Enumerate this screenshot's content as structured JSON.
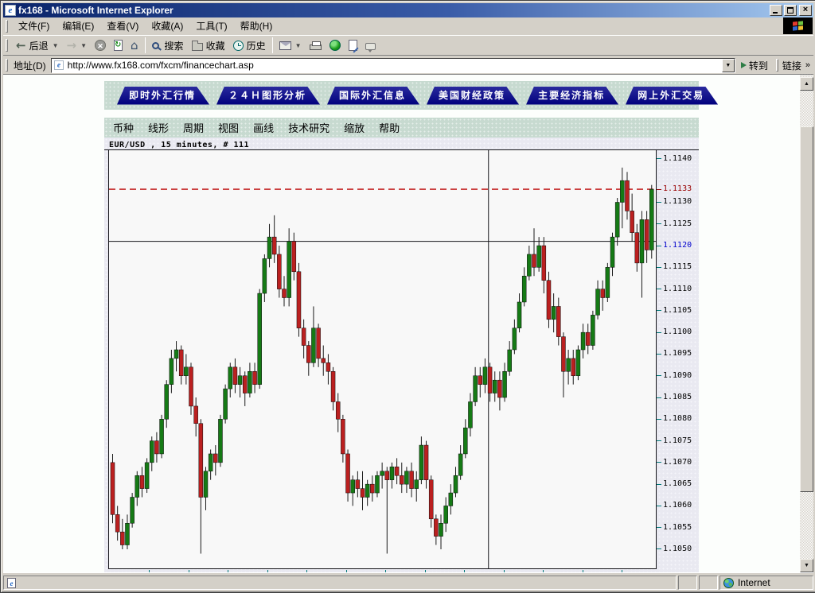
{
  "titlebar": {
    "title": "fx168 - Microsoft Internet Explorer"
  },
  "menubar": {
    "items": [
      "文件(F)",
      "编辑(E)",
      "查看(V)",
      "收藏(A)",
      "工具(T)",
      "帮助(H)"
    ]
  },
  "toolbar": {
    "back_label": "后退",
    "search_label": "搜索",
    "favorites_label": "收藏",
    "history_label": "历史"
  },
  "address": {
    "label": "地址(D)",
    "url": "http://www.fx168.com/fxcm/financechart.asp",
    "go_label": "转到",
    "links_label": "链接",
    "links_chevron": "»"
  },
  "nav_tabs": [
    "即时外汇行情",
    "２４Ｈ图形分析",
    "国际外汇信息",
    "美国财经政策",
    "主要经济指标",
    "网上外汇交易"
  ],
  "chart_menu": [
    "币种",
    "线形",
    "周期",
    "视图",
    "画线",
    "技术研究",
    "缩放",
    "帮助"
  ],
  "status": {
    "zone_label": "Internet"
  },
  "chart_data": {
    "type": "candlestick",
    "title": "EUR/USD , 15 minutes, # 111",
    "symbol": "EUR/USD",
    "interval": "15 minutes",
    "bar_count": 111,
    "ylim": [
      1.10456,
      1.1142
    ],
    "last_price": 1.1133,
    "lines": {
      "dashed_price": 1.1133,
      "dashed_color": "#bb0000",
      "solid_price": 1.1121,
      "vline_index": 76.7
    },
    "x_tick_count": 13,
    "style": {
      "up": "#157a15",
      "down": "#bb2020",
      "wick": "#1a1a1a",
      "axis_tick": "#007878",
      "bg": "#f8f8f8"
    },
    "y_ticks": [
      {
        "v": "1.1140"
      },
      {
        "v": "1.1133",
        "c": "#990000",
        "tick": "#990000"
      },
      {
        "v": "1.1130"
      },
      {
        "v": "1.1125"
      },
      {
        "v": "1.1120",
        "c": "#0000cc"
      },
      {
        "v": "1.1115"
      },
      {
        "v": "1.1110"
      },
      {
        "v": "1.1105"
      },
      {
        "v": "1.1100"
      },
      {
        "v": "1.1095"
      },
      {
        "v": "1.1090"
      },
      {
        "v": "1.1085"
      },
      {
        "v": "1.1080"
      },
      {
        "v": "1.1075"
      },
      {
        "v": "1.1070"
      },
      {
        "v": "1.1065"
      },
      {
        "v": "1.1060"
      },
      {
        "v": "1.1055"
      },
      {
        "v": "1.1050"
      }
    ],
    "candles": [
      [
        1.107,
        1.1072,
        1.1056,
        1.1058
      ],
      [
        1.1058,
        1.106,
        1.1052,
        1.1054
      ],
      [
        1.1054,
        1.1057,
        1.105,
        1.1051
      ],
      [
        1.1051,
        1.1058,
        1.105,
        1.1056
      ],
      [
        1.1056,
        1.1063,
        1.1055,
        1.1062
      ],
      [
        1.1062,
        1.1068,
        1.106,
        1.1067
      ],
      [
        1.1067,
        1.1069,
        1.1062,
        1.1064
      ],
      [
        1.1064,
        1.1071,
        1.1063,
        1.107
      ],
      [
        1.107,
        1.1076,
        1.1068,
        1.1075
      ],
      [
        1.1075,
        1.1077,
        1.107,
        1.1072
      ],
      [
        1.1072,
        1.1081,
        1.1071,
        1.108
      ],
      [
        1.108,
        1.1089,
        1.1078,
        1.1088
      ],
      [
        1.1088,
        1.1096,
        1.1086,
        1.1094
      ],
      [
        1.1094,
        1.1098,
        1.1091,
        1.1096
      ],
      [
        1.1096,
        1.1097,
        1.1088,
        1.109
      ],
      [
        1.109,
        1.1095,
        1.1088,
        1.1092
      ],
      [
        1.1092,
        1.1093,
        1.1081,
        1.1083
      ],
      [
        1.1083,
        1.1085,
        1.1076,
        1.1079
      ],
      [
        1.1079,
        1.108,
        1.1049,
        1.1062
      ],
      [
        1.1062,
        1.1069,
        1.1059,
        1.1068
      ],
      [
        1.1068,
        1.1073,
        1.1066,
        1.1072
      ],
      [
        1.1072,
        1.1074,
        1.1067,
        1.107
      ],
      [
        1.107,
        1.1081,
        1.1069,
        1.108
      ],
      [
        1.108,
        1.1088,
        1.1079,
        1.1087
      ],
      [
        1.1087,
        1.1093,
        1.1085,
        1.1092
      ],
      [
        1.1092,
        1.1094,
        1.1086,
        1.1088
      ],
      [
        1.1088,
        1.1092,
        1.1085,
        1.109
      ],
      [
        1.109,
        1.1091,
        1.1083,
        1.1086
      ],
      [
        1.1086,
        1.1093,
        1.1085,
        1.1091
      ],
      [
        1.1091,
        1.1093,
        1.1086,
        1.1088
      ],
      [
        1.1088,
        1.111,
        1.1087,
        1.1109
      ],
      [
        1.1109,
        1.1118,
        1.1107,
        1.1117
      ],
      [
        1.1117,
        1.1125,
        1.1115,
        1.1122
      ],
      [
        1.1122,
        1.1127,
        1.1116,
        1.1118
      ],
      [
        1.1118,
        1.112,
        1.1108,
        1.111
      ],
      [
        1.111,
        1.1113,
        1.1106,
        1.1108
      ],
      [
        1.1108,
        1.1124,
        1.1106,
        1.1121
      ],
      [
        1.1121,
        1.1123,
        1.1112,
        1.1114
      ],
      [
        1.1114,
        1.1116,
        1.1099,
        1.1101
      ],
      [
        1.1101,
        1.1103,
        1.1094,
        1.1097
      ],
      [
        1.1097,
        1.1098,
        1.109,
        1.1093
      ],
      [
        1.1093,
        1.1106,
        1.1092,
        1.1101
      ],
      [
        1.1101,
        1.1102,
        1.1092,
        1.1094
      ],
      [
        1.1094,
        1.1097,
        1.109,
        1.1093
      ],
      [
        1.1093,
        1.1095,
        1.1088,
        1.1091
      ],
      [
        1.1091,
        1.1092,
        1.1082,
        1.1084
      ],
      [
        1.1084,
        1.1086,
        1.1077,
        1.108
      ],
      [
        1.108,
        1.1081,
        1.107,
        1.1072
      ],
      [
        1.1072,
        1.1073,
        1.1061,
        1.1063
      ],
      [
        1.1063,
        1.1067,
        1.106,
        1.1066
      ],
      [
        1.1066,
        1.1068,
        1.1062,
        1.1064
      ],
      [
        1.1064,
        1.1068,
        1.1059,
        1.1062
      ],
      [
        1.1062,
        1.1066,
        1.106,
        1.1065
      ],
      [
        1.1065,
        1.1067,
        1.1061,
        1.1063
      ],
      [
        1.1063,
        1.1068,
        1.1062,
        1.1067
      ],
      [
        1.1067,
        1.107,
        1.1064,
        1.1068
      ],
      [
        1.1068,
        1.1069,
        1.1049,
        1.1066
      ],
      [
        1.1066,
        1.107,
        1.1064,
        1.1069
      ],
      [
        1.1069,
        1.1071,
        1.1065,
        1.1067
      ],
      [
        1.1067,
        1.107,
        1.1063,
        1.1065
      ],
      [
        1.1065,
        1.1069,
        1.1063,
        1.1068
      ],
      [
        1.1068,
        1.107,
        1.1062,
        1.1064
      ],
      [
        1.1064,
        1.1068,
        1.1061,
        1.1066
      ],
      [
        1.1066,
        1.1076,
        1.1065,
        1.1074
      ],
      [
        1.1074,
        1.1075,
        1.1064,
        1.1066
      ],
      [
        1.1066,
        1.1067,
        1.1055,
        1.1057
      ],
      [
        1.1057,
        1.1058,
        1.1051,
        1.1053
      ],
      [
        1.1053,
        1.1058,
        1.105,
        1.1056
      ],
      [
        1.1056,
        1.1062,
        1.1054,
        1.106
      ],
      [
        1.106,
        1.1065,
        1.1058,
        1.1063
      ],
      [
        1.1063,
        1.1069,
        1.1062,
        1.1067
      ],
      [
        1.1067,
        1.1074,
        1.1066,
        1.1072
      ],
      [
        1.1072,
        1.108,
        1.1071,
        1.1078
      ],
      [
        1.1078,
        1.1086,
        1.1076,
        1.1084
      ],
      [
        1.1084,
        1.1092,
        1.1083,
        1.109
      ],
      [
        1.109,
        1.1092,
        1.1085,
        1.1088
      ],
      [
        1.1088,
        1.1094,
        1.1086,
        1.1092
      ],
      [
        1.1092,
        1.1093,
        1.1084,
        1.1086
      ],
      [
        1.1086,
        1.1091,
        1.1084,
        1.1089
      ],
      [
        1.1089,
        1.1091,
        1.1082,
        1.1085
      ],
      [
        1.1085,
        1.1093,
        1.1084,
        1.1091
      ],
      [
        1.1091,
        1.1098,
        1.109,
        1.1096
      ],
      [
        1.1096,
        1.1103,
        1.1095,
        1.1101
      ],
      [
        1.1101,
        1.1109,
        1.11,
        1.1107
      ],
      [
        1.1107,
        1.1115,
        1.1106,
        1.1113
      ],
      [
        1.1113,
        1.112,
        1.1112,
        1.1118
      ],
      [
        1.1118,
        1.1124,
        1.1113,
        1.1115
      ],
      [
        1.1115,
        1.1122,
        1.1114,
        1.112
      ],
      [
        1.112,
        1.1122,
        1.1109,
        1.1112
      ],
      [
        1.1112,
        1.1114,
        1.1101,
        1.1103
      ],
      [
        1.1103,
        1.1109,
        1.11,
        1.1106
      ],
      [
        1.1106,
        1.1108,
        1.1097,
        1.1099
      ],
      [
        1.1099,
        1.11,
        1.1085,
        1.1091
      ],
      [
        1.1091,
        1.1096,
        1.1088,
        1.1094
      ],
      [
        1.1094,
        1.1096,
        1.1088,
        1.109
      ],
      [
        1.109,
        1.1097,
        1.1089,
        1.1096
      ],
      [
        1.1096,
        1.1102,
        1.1094,
        1.11
      ],
      [
        1.11,
        1.1102,
        1.1095,
        1.1097
      ],
      [
        1.1097,
        1.1105,
        1.1096,
        1.1104
      ],
      [
        1.1104,
        1.1112,
        1.1103,
        1.111
      ],
      [
        1.111,
        1.1112,
        1.1105,
        1.1108
      ],
      [
        1.1108,
        1.1116,
        1.1107,
        1.1115
      ],
      [
        1.1115,
        1.1123,
        1.1113,
        1.1122
      ],
      [
        1.1122,
        1.1131,
        1.112,
        1.113
      ],
      [
        1.113,
        1.1138,
        1.1124,
        1.1135
      ],
      [
        1.1135,
        1.1137,
        1.1126,
        1.1128
      ],
      [
        1.1128,
        1.1132,
        1.1121,
        1.1123
      ],
      [
        1.1123,
        1.1125,
        1.1114,
        1.1116
      ],
      [
        1.1116,
        1.1128,
        1.1108,
        1.1126
      ],
      [
        1.1126,
        1.1128,
        1.1116,
        1.1119
      ],
      [
        1.1119,
        1.1134,
        1.1117,
        1.1133
      ]
    ]
  }
}
